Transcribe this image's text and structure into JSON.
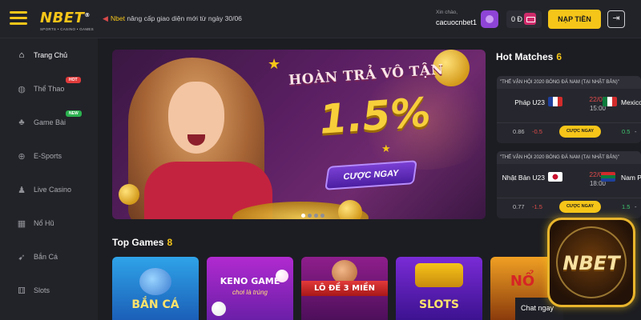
{
  "header": {
    "logo_text": "NBET",
    "logo_sub": "SPORTS • CASINO • GAMES",
    "notice_brand": "Nbet",
    "notice_text": " nâng cấp giao diện mới từ ngày 30/06",
    "greeting": "Xin chào,",
    "username": "cacuocnbet1",
    "balance": "0 Đ",
    "deposit_label": "NẠP TIỀN"
  },
  "sidebar": {
    "items": [
      {
        "label": "Trang Chủ",
        "icon": "home-icon"
      },
      {
        "label": "Thể Thao",
        "icon": "ball-icon",
        "badge": "HOT"
      },
      {
        "label": "Game Bài",
        "icon": "cards-icon",
        "badge": "NEW"
      },
      {
        "label": "E-Sports",
        "icon": "gamepad-icon"
      },
      {
        "label": "Live Casino",
        "icon": "dealer-icon"
      },
      {
        "label": "Nổ Hũ",
        "icon": "slot-icon"
      },
      {
        "label": "Bắn Cá",
        "icon": "fish-icon"
      },
      {
        "label": "Slots",
        "icon": "slots-icon"
      }
    ]
  },
  "banner": {
    "title": "HOÀN TRẢ VÔ TẬN",
    "percent": "1.5%",
    "cta": "CƯỢC NGAY"
  },
  "hot_matches": {
    "title": "Hot Matches",
    "count": "6",
    "matches": [
      {
        "league": "\"THẾ VẬN HỘI 2020 BÓNG ĐÁ NAM (TẠI NHẬT BẢN)\"",
        "home": "Pháp U23",
        "away": "Mexico",
        "date": "22/07",
        "time": "15:00",
        "odd_home": "0.86",
        "handicap_home": "-0.5",
        "bet_label": "CƯỢC NGAY",
        "handicap_away": "0.5",
        "odd_away": "-"
      },
      {
        "league": "\"THẾ VẬN HỘI 2020 BÓNG ĐÁ NAM (TẠI NHẬT BẢN)\"",
        "home": "Nhật Bản U23",
        "away": "Nam Phi",
        "date": "22/07",
        "time": "18:00",
        "odd_home": "0.77",
        "handicap_home": "-1.5",
        "bet_label": "CƯỢC NGAY",
        "handicap_away": "1.5",
        "odd_away": "-"
      }
    ]
  },
  "top_games": {
    "title": "Top Games",
    "count": "8",
    "games": [
      {
        "label": "BẮN CÁ"
      },
      {
        "label": "KENO GAME",
        "sub": "chơi là trúng"
      },
      {
        "label": "LÔ ĐỀ 3 MIỀN"
      },
      {
        "label": "SLOTS"
      },
      {
        "label": "NỔ"
      }
    ]
  },
  "chat": {
    "label": "Chat ngay"
  },
  "floating_logo": {
    "text": "NBET"
  },
  "colors": {
    "accent": "#f5c519",
    "background": "#1c1d22",
    "panel": "#222329"
  }
}
